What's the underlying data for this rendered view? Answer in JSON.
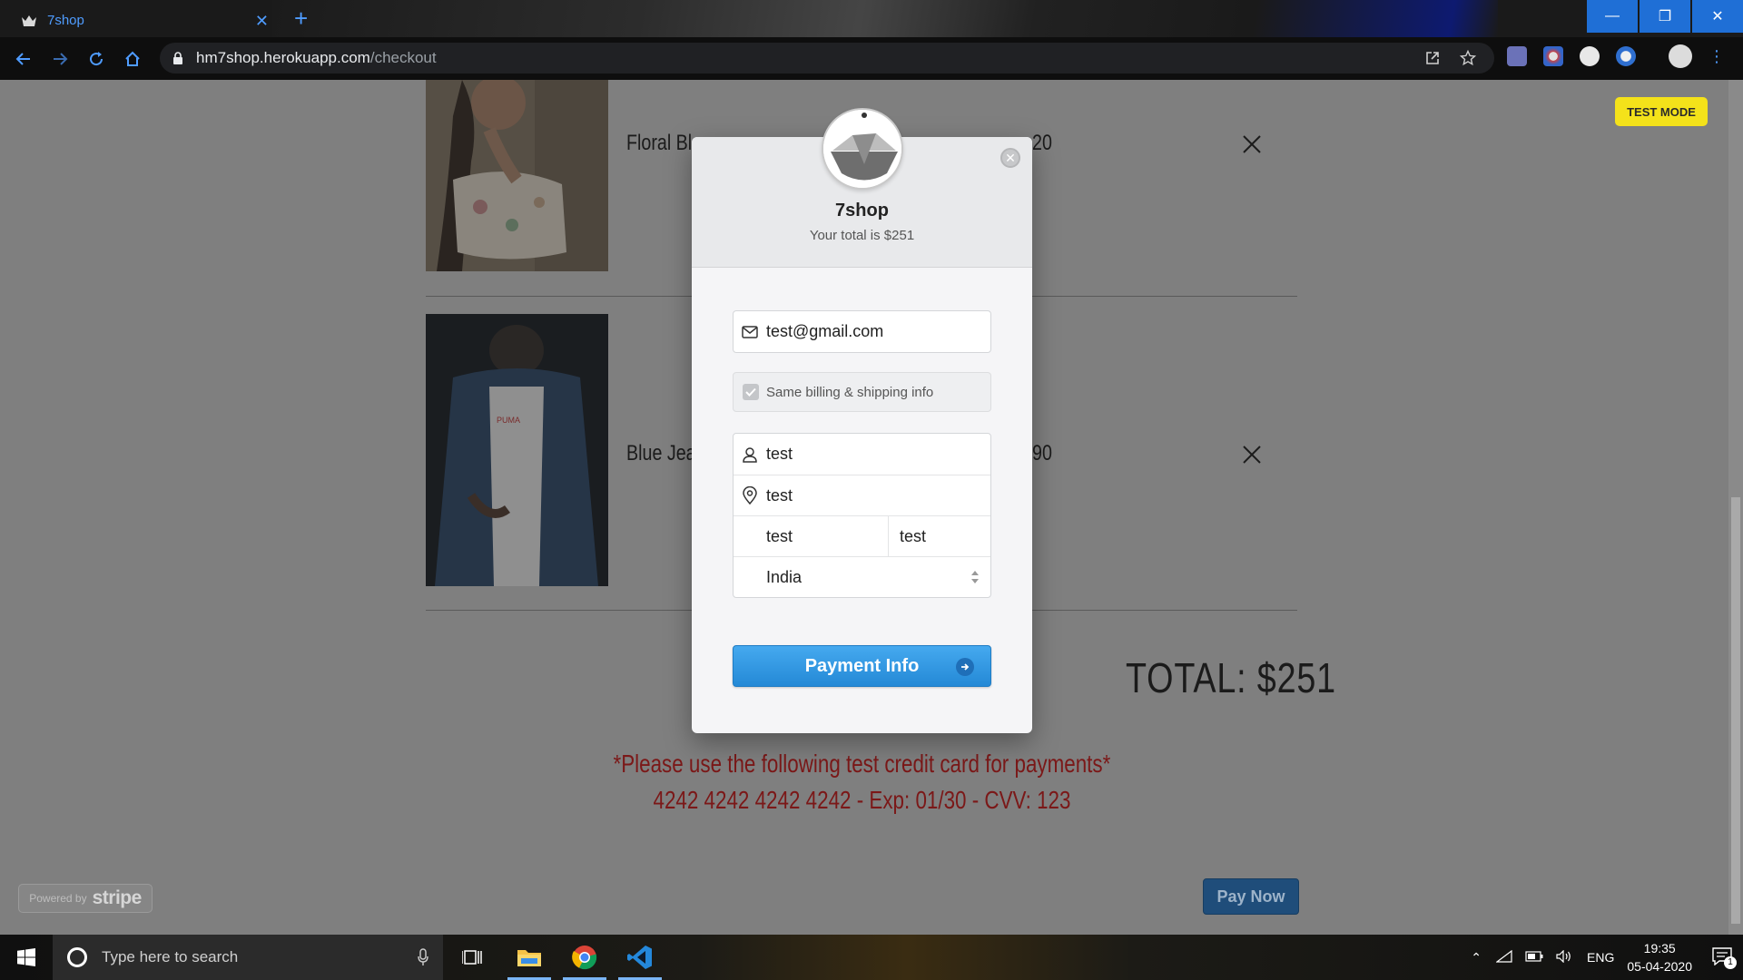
{
  "browser": {
    "tab_title": "7shop",
    "tab_close": "✕",
    "new_tab": "+",
    "url_host": "hm7shop.herokuapp.com",
    "url_path": "/checkout",
    "window_buttons": [
      "—",
      "❐",
      "✕"
    ]
  },
  "page": {
    "test_mode_badge": "TEST MODE",
    "products": [
      {
        "name": "Floral Blo",
        "price": "20"
      },
      {
        "name": "Blue Jear",
        "price": "90"
      }
    ],
    "total": "TOTAL: $251",
    "note_line1": "*Please use the following test credit card for payments*",
    "note_line2": "4242 4242 4242 4242 - Exp: 01/30 - CVV: 123",
    "pay_now": "Pay Now",
    "stripe_badge": {
      "powered_by": "Powered by",
      "brand": "stripe"
    }
  },
  "modal": {
    "title": "7shop",
    "subtitle": "Your total is $251",
    "close": "✕",
    "email": "test@gmail.com",
    "same_billing_label": "Same billing & shipping info",
    "name": "test",
    "address": "test",
    "city": "test",
    "zip": "test",
    "country": "India",
    "submit": "Payment Info"
  },
  "taskbar": {
    "search_placeholder": "Type here to search",
    "language": "ENG",
    "time": "19:35",
    "date": "05-04-2020",
    "notification_count": "1"
  },
  "colors": {
    "accent": "#2489d6",
    "test_mode": "#f4e21a",
    "note": "#7b1818"
  }
}
